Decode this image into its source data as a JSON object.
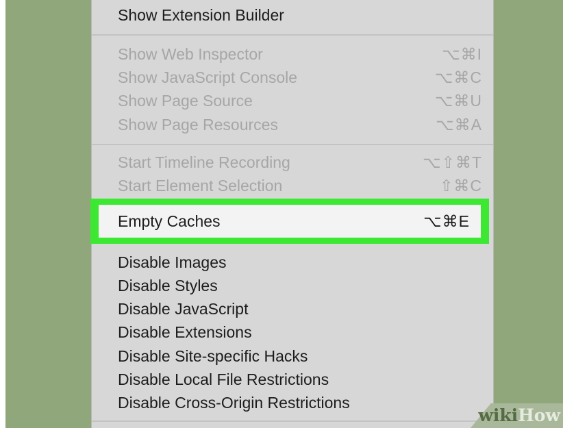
{
  "menu": {
    "top_item": {
      "label": "Show Extension Builder"
    },
    "group_inspect": [
      {
        "label": "Show Web Inspector",
        "shortcut": "⌥⌘I"
      },
      {
        "label": "Show JavaScript Console",
        "shortcut": "⌥⌘C"
      },
      {
        "label": "Show Page Source",
        "shortcut": "⌥⌘U"
      },
      {
        "label": "Show Page Resources",
        "shortcut": "⌥⌘A"
      }
    ],
    "group_recording": [
      {
        "label": "Start Timeline Recording",
        "shortcut": "⌥⇧⌘T"
      },
      {
        "label": "Start Element Selection",
        "shortcut": "⇧⌘C"
      }
    ],
    "highlighted": {
      "label": "Empty Caches",
      "shortcut": "⌥⌘E"
    },
    "group_disable": [
      {
        "label": "Disable Images"
      },
      {
        "label": "Disable Styles"
      },
      {
        "label": "Disable JavaScript"
      },
      {
        "label": "Disable Extensions"
      },
      {
        "label": "Disable Site-specific Hacks"
      },
      {
        "label": "Disable Local File Restrictions"
      },
      {
        "label": "Disable Cross-Origin Restrictions"
      }
    ]
  },
  "colors": {
    "background": "#8fa77b",
    "menu_bg": "#d7d7d7",
    "highlight_border": "#3ce831",
    "enabled_text": "#1c1c1c",
    "disabled_text": "#a6a6a6"
  },
  "watermark": {
    "wiki": "wiki",
    "how": "How"
  }
}
